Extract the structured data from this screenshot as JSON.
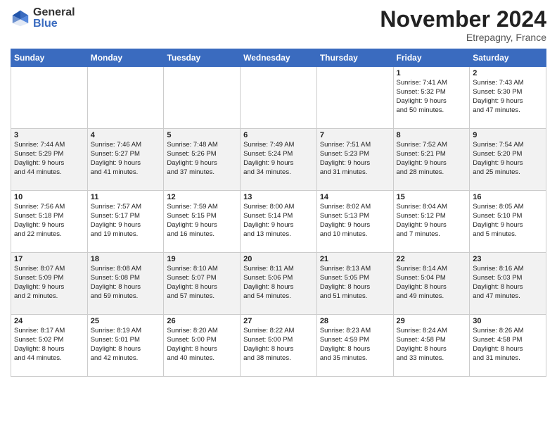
{
  "logo": {
    "general": "General",
    "blue": "Blue"
  },
  "title": "November 2024",
  "location": "Etrepagny, France",
  "days_header": [
    "Sunday",
    "Monday",
    "Tuesday",
    "Wednesday",
    "Thursday",
    "Friday",
    "Saturday"
  ],
  "weeks": [
    [
      {
        "day": "",
        "info": ""
      },
      {
        "day": "",
        "info": ""
      },
      {
        "day": "",
        "info": ""
      },
      {
        "day": "",
        "info": ""
      },
      {
        "day": "",
        "info": ""
      },
      {
        "day": "1",
        "info": "Sunrise: 7:41 AM\nSunset: 5:32 PM\nDaylight: 9 hours\nand 50 minutes."
      },
      {
        "day": "2",
        "info": "Sunrise: 7:43 AM\nSunset: 5:30 PM\nDaylight: 9 hours\nand 47 minutes."
      }
    ],
    [
      {
        "day": "3",
        "info": "Sunrise: 7:44 AM\nSunset: 5:29 PM\nDaylight: 9 hours\nand 44 minutes."
      },
      {
        "day": "4",
        "info": "Sunrise: 7:46 AM\nSunset: 5:27 PM\nDaylight: 9 hours\nand 41 minutes."
      },
      {
        "day": "5",
        "info": "Sunrise: 7:48 AM\nSunset: 5:26 PM\nDaylight: 9 hours\nand 37 minutes."
      },
      {
        "day": "6",
        "info": "Sunrise: 7:49 AM\nSunset: 5:24 PM\nDaylight: 9 hours\nand 34 minutes."
      },
      {
        "day": "7",
        "info": "Sunrise: 7:51 AM\nSunset: 5:23 PM\nDaylight: 9 hours\nand 31 minutes."
      },
      {
        "day": "8",
        "info": "Sunrise: 7:52 AM\nSunset: 5:21 PM\nDaylight: 9 hours\nand 28 minutes."
      },
      {
        "day": "9",
        "info": "Sunrise: 7:54 AM\nSunset: 5:20 PM\nDaylight: 9 hours\nand 25 minutes."
      }
    ],
    [
      {
        "day": "10",
        "info": "Sunrise: 7:56 AM\nSunset: 5:18 PM\nDaylight: 9 hours\nand 22 minutes."
      },
      {
        "day": "11",
        "info": "Sunrise: 7:57 AM\nSunset: 5:17 PM\nDaylight: 9 hours\nand 19 minutes."
      },
      {
        "day": "12",
        "info": "Sunrise: 7:59 AM\nSunset: 5:15 PM\nDaylight: 9 hours\nand 16 minutes."
      },
      {
        "day": "13",
        "info": "Sunrise: 8:00 AM\nSunset: 5:14 PM\nDaylight: 9 hours\nand 13 minutes."
      },
      {
        "day": "14",
        "info": "Sunrise: 8:02 AM\nSunset: 5:13 PM\nDaylight: 9 hours\nand 10 minutes."
      },
      {
        "day": "15",
        "info": "Sunrise: 8:04 AM\nSunset: 5:12 PM\nDaylight: 9 hours\nand 7 minutes."
      },
      {
        "day": "16",
        "info": "Sunrise: 8:05 AM\nSunset: 5:10 PM\nDaylight: 9 hours\nand 5 minutes."
      }
    ],
    [
      {
        "day": "17",
        "info": "Sunrise: 8:07 AM\nSunset: 5:09 PM\nDaylight: 9 hours\nand 2 minutes."
      },
      {
        "day": "18",
        "info": "Sunrise: 8:08 AM\nSunset: 5:08 PM\nDaylight: 8 hours\nand 59 minutes."
      },
      {
        "day": "19",
        "info": "Sunrise: 8:10 AM\nSunset: 5:07 PM\nDaylight: 8 hours\nand 57 minutes."
      },
      {
        "day": "20",
        "info": "Sunrise: 8:11 AM\nSunset: 5:06 PM\nDaylight: 8 hours\nand 54 minutes."
      },
      {
        "day": "21",
        "info": "Sunrise: 8:13 AM\nSunset: 5:05 PM\nDaylight: 8 hours\nand 51 minutes."
      },
      {
        "day": "22",
        "info": "Sunrise: 8:14 AM\nSunset: 5:04 PM\nDaylight: 8 hours\nand 49 minutes."
      },
      {
        "day": "23",
        "info": "Sunrise: 8:16 AM\nSunset: 5:03 PM\nDaylight: 8 hours\nand 47 minutes."
      }
    ],
    [
      {
        "day": "24",
        "info": "Sunrise: 8:17 AM\nSunset: 5:02 PM\nDaylight: 8 hours\nand 44 minutes."
      },
      {
        "day": "25",
        "info": "Sunrise: 8:19 AM\nSunset: 5:01 PM\nDaylight: 8 hours\nand 42 minutes."
      },
      {
        "day": "26",
        "info": "Sunrise: 8:20 AM\nSunset: 5:00 PM\nDaylight: 8 hours\nand 40 minutes."
      },
      {
        "day": "27",
        "info": "Sunrise: 8:22 AM\nSunset: 5:00 PM\nDaylight: 8 hours\nand 38 minutes."
      },
      {
        "day": "28",
        "info": "Sunrise: 8:23 AM\nSunset: 4:59 PM\nDaylight: 8 hours\nand 35 minutes."
      },
      {
        "day": "29",
        "info": "Sunrise: 8:24 AM\nSunset: 4:58 PM\nDaylight: 8 hours\nand 33 minutes."
      },
      {
        "day": "30",
        "info": "Sunrise: 8:26 AM\nSunset: 4:58 PM\nDaylight: 8 hours\nand 31 minutes."
      }
    ]
  ]
}
